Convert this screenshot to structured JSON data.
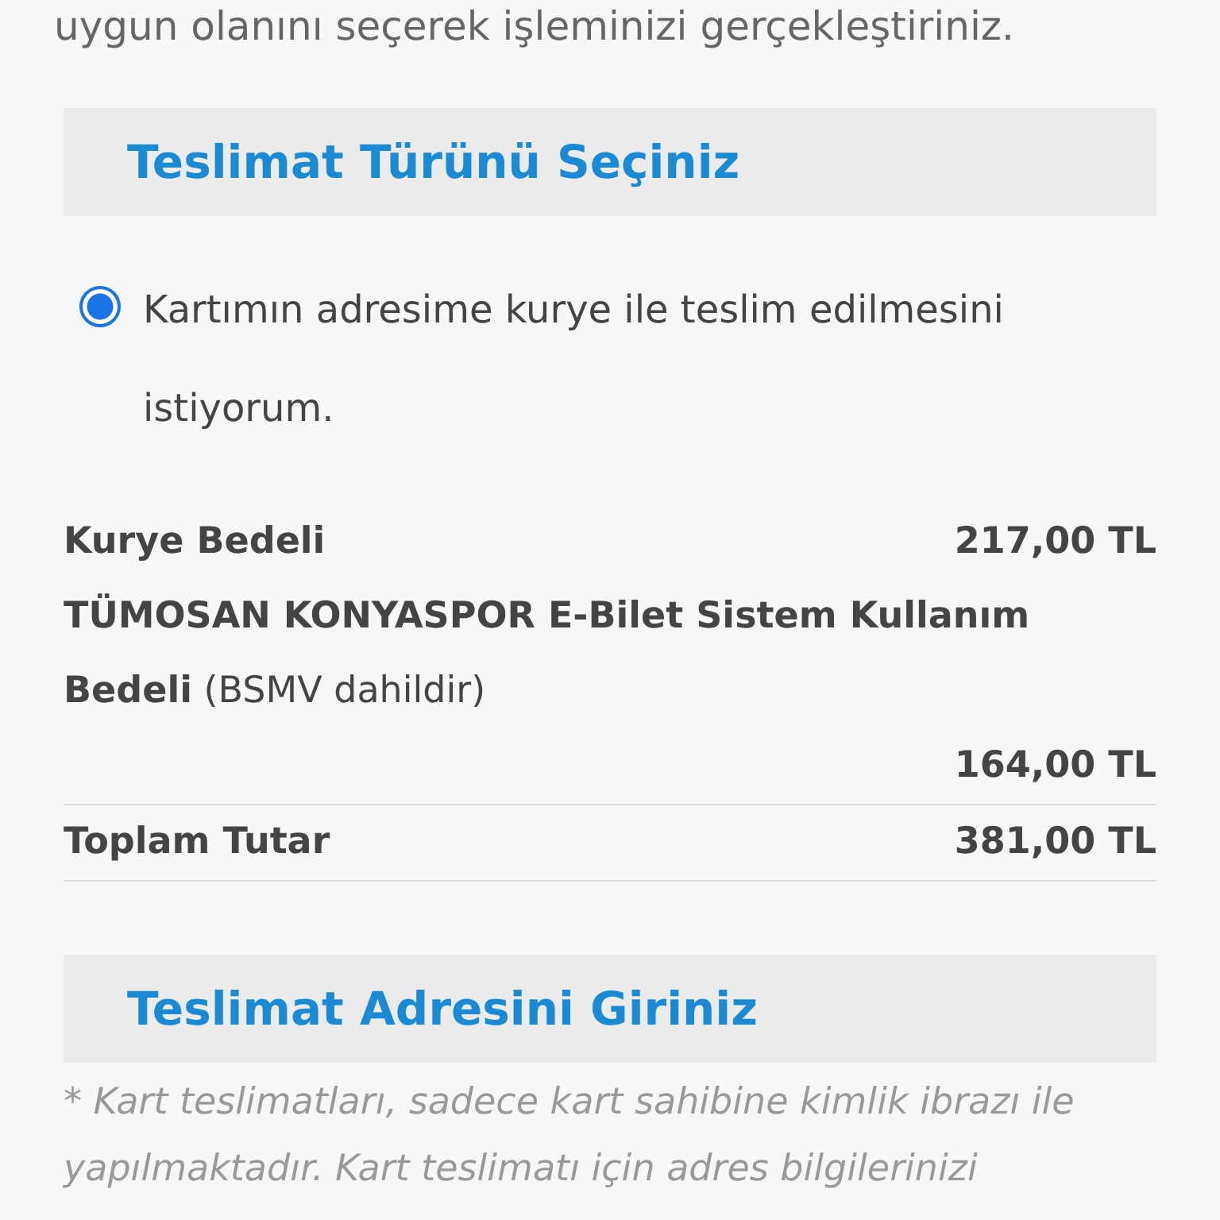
{
  "intro": "uygun olanını seçerek işleminizi gerçekleştiriniz.",
  "delivery_section": {
    "title": "Teslimat Türünü Seçiniz",
    "options": [
      {
        "label": "Kartımın adresime kurye ile teslim edilmesini istiyorum.",
        "selected": true
      }
    ]
  },
  "fees": [
    {
      "label": "Kurye Bedeli",
      "amount": "217,00 TL"
    },
    {
      "label": "**TÜMOSAN KONYASPOR E-Bilet Sistem Kullanım Bedeli** (BSMV dahildir)",
      "amount": "164,00 TL"
    }
  ],
  "total": {
    "label": "Toplam Tutar",
    "amount": "381,00 TL"
  },
  "address_section": {
    "title": "Teslimat Adresini Giriniz",
    "note": "* Kart teslimatları, sadece kart sahibine kimlik ibrazı ile yapılmaktadır. Kart teslimatı için adres bilgilerinizi"
  }
}
